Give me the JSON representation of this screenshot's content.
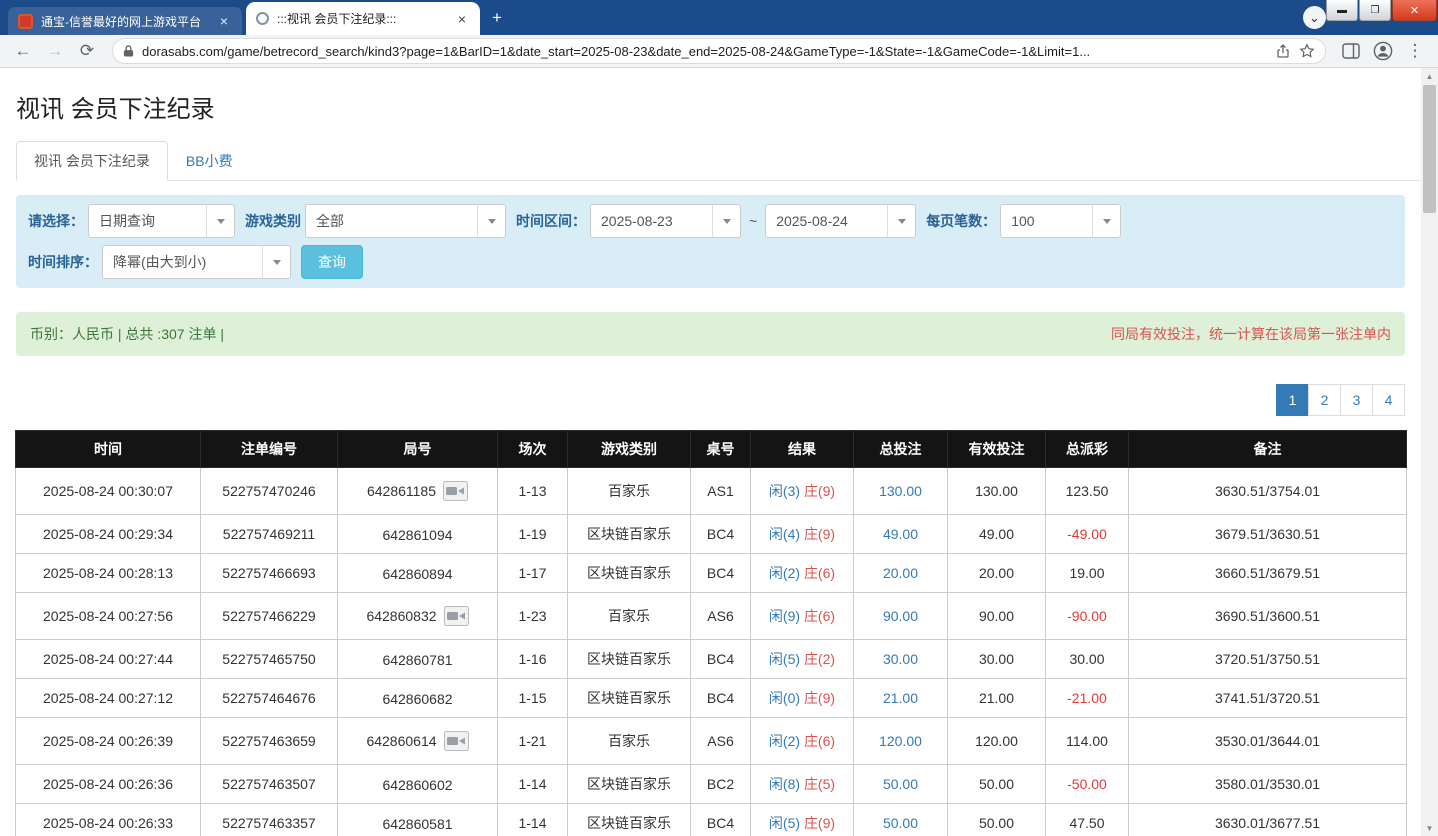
{
  "palette": {
    "frame_blue": "#1b4b8a",
    "accent_blue": "#337ab7",
    "label_blue": "#2a6496",
    "player_blue": "#337ab7",
    "banker_red": "#d9534f",
    "negative_red": "#e03a3a",
    "warning_red": "#d9534f",
    "filter_bg": "#d9edf7",
    "summary_bg": "#dff0d8",
    "summary_text": "#3c763d",
    "table_header_bg": "#141414"
  },
  "browser": {
    "tabs": [
      {
        "title": "通宝-信誉最好的网上游戏平台"
      },
      {
        "title": ":::视讯 会员下注纪录:::"
      }
    ],
    "new_tab_label": "+",
    "url": "dorasabs.com/game/betrecord_search/kind3?page=1&BarID=1&date_start=2025-08-23&date_end=2025-08-24&GameType=-1&State=-1&GameCode=-1&Limit=1..."
  },
  "page": {
    "title": "视讯 会员下注纪录",
    "nav_tabs": [
      {
        "label": "视讯 会员下注纪录",
        "active": true
      },
      {
        "label": "BB小费",
        "active": false
      }
    ],
    "filters": {
      "select_label": "请选择：",
      "select_value": "日期查询",
      "game_label": "游戏类别",
      "game_value": "全部",
      "range_label": "时间区间：",
      "date_start": "2025-08-23",
      "tilde": "~",
      "date_end": "2025-08-24",
      "per_page_label": "每页笔数：",
      "per_page_value": "100",
      "sort_label": "时间排序：",
      "sort_value": "降幂(由大到小)",
      "search_button": "查询"
    },
    "summary": {
      "left": "币别：人民币 | 总共 :307 注单 |",
      "right": "同局有效投注，统一计算在该局第一张注单内"
    },
    "pagination": [
      {
        "label": "1",
        "active": true
      },
      {
        "label": "2",
        "active": false
      },
      {
        "label": "3",
        "active": false
      },
      {
        "label": "4",
        "active": false
      }
    ],
    "table": {
      "headers": [
        "时间",
        "注单编号",
        "局号",
        "场次",
        "游戏类别",
        "桌号",
        "结果",
        "总投注",
        "有效投注",
        "总派彩",
        "备注"
      ],
      "rows": [
        {
          "time": "2025-08-24 00:30:07",
          "bet_id": "522757470246",
          "round": "642861185",
          "video": true,
          "session": "1-13",
          "game": "百家乐",
          "table_no": "AS1",
          "player": "闲(3)",
          "banker": "庄(9)",
          "total_bet": "130.00",
          "valid_bet": "130.00",
          "payout": "123.50",
          "note": "3630.51/3754.01"
        },
        {
          "time": "2025-08-24 00:29:34",
          "bet_id": "522757469211",
          "round": "642861094",
          "video": false,
          "session": "1-19",
          "game": "区块链百家乐",
          "table_no": "BC4",
          "player": "闲(4)",
          "banker": "庄(9)",
          "total_bet": "49.00",
          "valid_bet": "49.00",
          "payout": "-49.00",
          "note": "3679.51/3630.51"
        },
        {
          "time": "2025-08-24 00:28:13",
          "bet_id": "522757466693",
          "round": "642860894",
          "video": false,
          "session": "1-17",
          "game": "区块链百家乐",
          "table_no": "BC4",
          "player": "闲(2)",
          "banker": "庄(6)",
          "total_bet": "20.00",
          "valid_bet": "20.00",
          "payout": "19.00",
          "note": "3660.51/3679.51"
        },
        {
          "time": "2025-08-24 00:27:56",
          "bet_id": "522757466229",
          "round": "642860832",
          "video": true,
          "session": "1-23",
          "game": "百家乐",
          "table_no": "AS6",
          "player": "闲(9)",
          "banker": "庄(6)",
          "total_bet": "90.00",
          "valid_bet": "90.00",
          "payout": "-90.00",
          "note": "3690.51/3600.51"
        },
        {
          "time": "2025-08-24 00:27:44",
          "bet_id": "522757465750",
          "round": "642860781",
          "video": false,
          "session": "1-16",
          "game": "区块链百家乐",
          "table_no": "BC4",
          "player": "闲(5)",
          "banker": "庄(2)",
          "total_bet": "30.00",
          "valid_bet": "30.00",
          "payout": "30.00",
          "note": "3720.51/3750.51"
        },
        {
          "time": "2025-08-24 00:27:12",
          "bet_id": "522757464676",
          "round": "642860682",
          "video": false,
          "session": "1-15",
          "game": "区块链百家乐",
          "table_no": "BC4",
          "player": "闲(0)",
          "banker": "庄(9)",
          "total_bet": "21.00",
          "valid_bet": "21.00",
          "payout": "-21.00",
          "note": "3741.51/3720.51"
        },
        {
          "time": "2025-08-24 00:26:39",
          "bet_id": "522757463659",
          "round": "642860614",
          "video": true,
          "session": "1-21",
          "game": "百家乐",
          "table_no": "AS6",
          "player": "闲(2)",
          "banker": "庄(6)",
          "total_bet": "120.00",
          "valid_bet": "120.00",
          "payout": "114.00",
          "note": "3530.01/3644.01"
        },
        {
          "time": "2025-08-24 00:26:36",
          "bet_id": "522757463507",
          "round": "642860602",
          "video": false,
          "session": "1-14",
          "game": "区块链百家乐",
          "table_no": "BC2",
          "player": "闲(8)",
          "banker": "庄(5)",
          "total_bet": "50.00",
          "valid_bet": "50.00",
          "payout": "-50.00",
          "note": "3580.01/3530.01"
        },
        {
          "time": "2025-08-24 00:26:33",
          "bet_id": "522757463357",
          "round": "642860581",
          "video": false,
          "session": "1-14",
          "game": "区块链百家乐",
          "table_no": "BC4",
          "player": "闲(5)",
          "banker": "庄(9)",
          "total_bet": "50.00",
          "valid_bet": "50.00",
          "payout": "47.50",
          "note": "3630.01/3677.51"
        }
      ]
    }
  }
}
